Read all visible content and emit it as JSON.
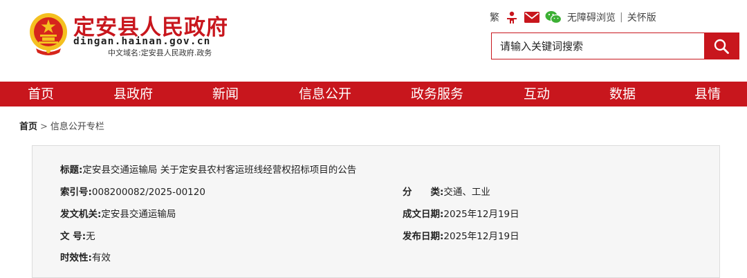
{
  "site": {
    "title": "定安县人民政府",
    "domain": "dingan.hainan.gov.cn",
    "cn_domain": "中文域名:定安县人民政府.政务"
  },
  "tools": {
    "traditional": "繁",
    "accessibility": "无障碍浏览",
    "separator": "|",
    "elderly": "关怀版"
  },
  "search": {
    "placeholder": "请输入关键词搜索"
  },
  "nav": {
    "items": [
      "首页",
      "县政府",
      "新闻",
      "信息公开",
      "政务服务",
      "互动",
      "数据",
      "县情"
    ]
  },
  "breadcrumb": {
    "home": "首页",
    "sep": ">",
    "current": "信息公开专栏"
  },
  "meta": {
    "title_key": "标题:",
    "title_val": "定安县交通运输局 关于定安县农村客运班线经营权招标项目的公告",
    "index_key": "索引号:",
    "index_val": "008200082/2025-00120",
    "category_key": "分　　类:",
    "category_val": "交通、工业",
    "issuer_key": "发文机关:",
    "issuer_val": "定安县交通运输局",
    "date_key": "成文日期:",
    "date_val": "2025年12月19日",
    "docno_key": "文  号:",
    "docno_val": "无",
    "pubdate_key": "发布日期:",
    "pubdate_val": "2025年12月19日",
    "validity_key": "时效性:",
    "validity_val": "有效"
  },
  "colors": {
    "brand_red": "#c8161d",
    "emblem_gold": "#f4c020",
    "wechat_green": "#3cb034"
  },
  "icons": [
    "national-emblem-icon",
    "elderly-icon",
    "mail-icon",
    "wechat-icon",
    "search-icon"
  ]
}
